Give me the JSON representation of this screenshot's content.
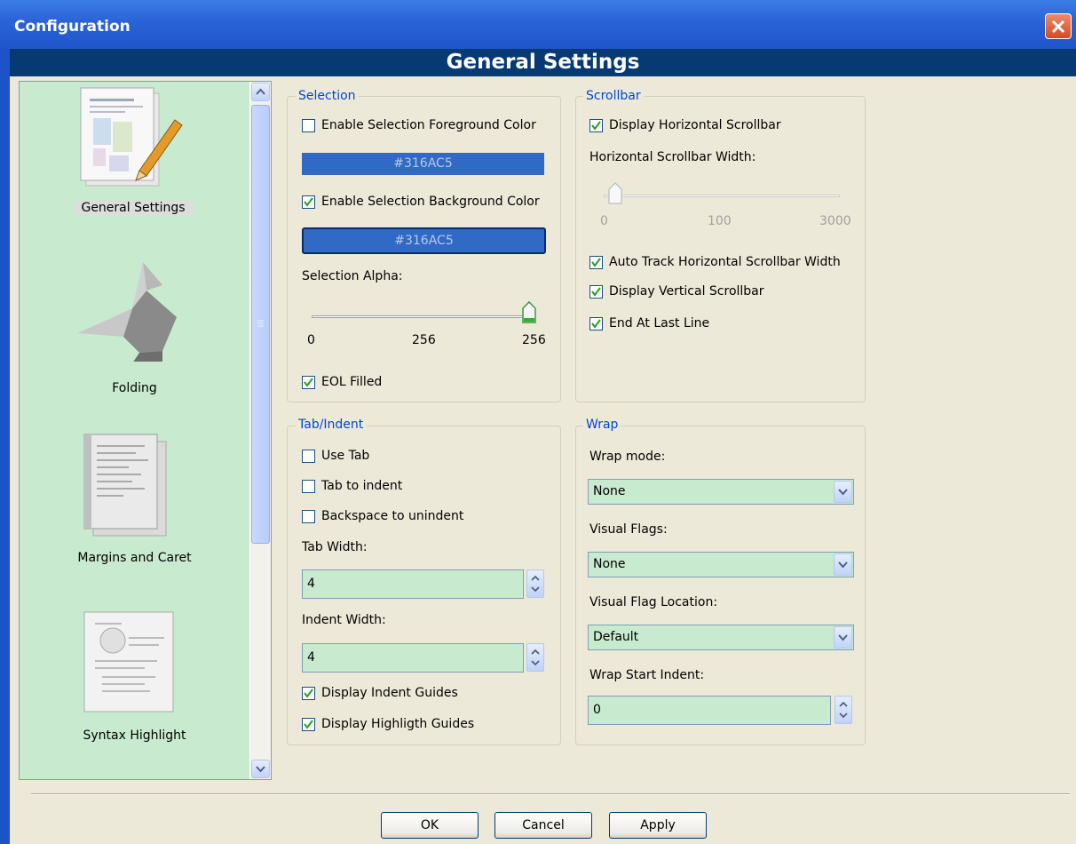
{
  "window": {
    "title": "Configuration"
  },
  "header": {
    "title": "General Settings"
  },
  "sidebar": {
    "items": [
      {
        "label": "General Settings",
        "icon": "general-settings-icon"
      },
      {
        "label": "Folding",
        "icon": "folding-icon"
      },
      {
        "label": "Margins and Caret",
        "icon": "margins-caret-icon"
      },
      {
        "label": "Syntax Highlight",
        "icon": "syntax-highlight-icon"
      }
    ]
  },
  "selection": {
    "legend": "Selection",
    "fg_enabled_label": "Enable Selection Foreground Color",
    "fg_enabled": false,
    "fg_color": "#316AC5",
    "bg_enabled_label": "Enable Selection Background Color",
    "bg_enabled": true,
    "bg_color": "#316AC5",
    "alpha_label": "Selection Alpha:",
    "alpha_min": "0",
    "alpha_value": "256",
    "alpha_max": "256",
    "alpha_level": 1.0,
    "eol_label": "EOL Filled",
    "eol_filled": true
  },
  "scrollbar": {
    "legend": "Scrollbar",
    "display_h_label": "Display Horizontal Scrollbar",
    "display_h": true,
    "h_width_label": "Horizontal Scrollbar Width:",
    "h_width_min": "0",
    "h_width_value": "100",
    "h_width_max": "3000",
    "auto_track_label": "Auto Track Horizontal Scrollbar Width",
    "auto_track": true,
    "display_v_label": "Display Vertical Scrollbar",
    "display_v": true,
    "end_last_label": "End At Last Line",
    "end_last": true
  },
  "tab_indent": {
    "legend": "Tab/Indent",
    "use_tab_label": "Use Tab",
    "use_tab": false,
    "tab_to_indent_label": "Tab to indent",
    "tab_to_indent": false,
    "backspace_label": "Backspace to unindent",
    "backspace": false,
    "tab_width_label": "Tab Width:",
    "tab_width": "4",
    "indent_width_label": "Indent Width:",
    "indent_width": "4",
    "indent_guides_label": "Display Indent Guides",
    "indent_guides": true,
    "highlight_guides_label": "Display Highligth Guides",
    "highlight_guides": true
  },
  "wrap": {
    "legend": "Wrap",
    "mode_label": "Wrap mode:",
    "mode": "None",
    "flags_label": "Visual Flags:",
    "flags": "None",
    "flag_loc_label": "Visual Flag Location:",
    "flag_loc": "Default",
    "start_indent_label": "Wrap Start Indent:",
    "start_indent": "0"
  },
  "buttons": {
    "ok": "OK",
    "cancel": "Cancel",
    "apply": "Apply"
  },
  "colors": {
    "titlebar": "#2A62D8",
    "header": "#073A73",
    "sidebar_bg": "#C8EBCF",
    "field_bg": "#C8EBCF",
    "legend": "#0046D5"
  }
}
